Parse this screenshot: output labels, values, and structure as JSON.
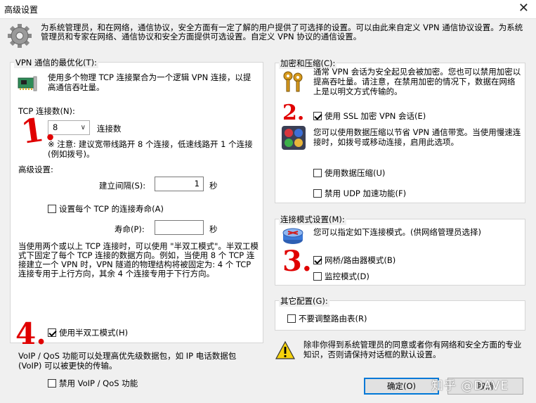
{
  "window": {
    "title": "高级设置",
    "close_glyph": "✕"
  },
  "intro": "为系统管理员，和在网络，通信协议，安全方面有一定了解的用户提供了可选择的设置。可以由此来自定义 VPN 通信协议设置。为系统管理员和专家在网络、通信协议和安全方面提供可选设置。自定义 VPN 协议的通信设置。",
  "vpn_opt": {
    "label": "VPN 通信的最优化(T):",
    "desc": "使用多个物理 TCP 连接聚合为一个逻辑 VPN 连接，以提高通信吞吐量。",
    "tcp_count_label": "TCP 连接数(N):",
    "tcp_count_value": "8",
    "tcp_count_unit": "连接数",
    "note": "※ 注意: 建议宽带线路开 8 个连接，低速线路开 1 个连接 (例如拨号)。",
    "advanced_label": "高级设置:",
    "interval_label": "建立间隔(S):",
    "interval_value": "1",
    "interval_unit": "秒",
    "lifetime_cb_label": "设置每个 TCP 的连接寿命(A)",
    "lifetime_label": "寿命(P):",
    "lifetime_value": "",
    "lifetime_unit": "秒",
    "halfduplex_desc": "当使用两个或以上 TCP 连接时，可以使用 \"半双工模式\"。半双工模式下固定了每个 TCP 连接的数据方向。例如，当使用 8 个 TCP 连接建立一个 VPN 时，VPN 隧道的物理结构将被固定为: 4 个 TCP 连接专用于上行方向，其余 4 个连接专用于下行方向。",
    "halfduplex_cb_label": "使用半双工模式(H)",
    "qos_desc": "VoIP / QoS 功能可以处理高优先级数据包，如 IP 电话数据包 (VoIP) 可以被更快的传输。",
    "qos_cb_label": "禁用 VoIP / QoS 功能"
  },
  "encrypt": {
    "label": "加密和压缩(C):",
    "desc": "通常 VPN 会话为安全起见会被加密。您也可以禁用加密以提高吞吐量。请注意，在禁用加密的情况下，数据在网络上是以明文方式传输的。",
    "ssl_cb_label": "使用 SSL 加密 VPN 会话(E)",
    "compress_desc": "您可以使用数据压缩以节省 VPN 通信带宽。当使用慢速连接时，如拨号或移动连接，启用此选项。",
    "compress_cb_label": "使用数据压缩(U)",
    "udp_cb_label": "禁用 UDP 加速功能(F)"
  },
  "mode": {
    "label": "连接模式设置(M):",
    "desc": "您可以指定如下连接模式。(供网络管理员选择)",
    "bridge_cb_label": "网桥/路由器模式(B)",
    "monitor_cb_label": "监控模式(D)"
  },
  "other": {
    "label": "其它配置(G):",
    "route_cb_label": "不要调整路由表(R)"
  },
  "warning": "除非你得到系统管理员的同意或者你有网络和安全方面的专业知识，否则请保持对话框的默认设置。",
  "buttons": {
    "ok": "确定(O)",
    "cancel": "取消"
  },
  "annotations": {
    "a1": "1.",
    "a2": "2.",
    "a3": "3.",
    "a4": "4."
  },
  "watermark": "知乎 @DAVE",
  "checks": {
    "lifetime": false,
    "halfduplex": true,
    "qos": false,
    "ssl": true,
    "compress": false,
    "udp": false,
    "bridge": true,
    "monitor": false,
    "route": false
  },
  "icons": {
    "gear": "gear-icon",
    "nic": "network-card-icon",
    "keys": "keys-icon",
    "compress": "compression-icon",
    "router": "router-icon",
    "warning": "warning-icon"
  },
  "colors": {
    "annotation": "#e00000",
    "accent": "#0078d7"
  }
}
